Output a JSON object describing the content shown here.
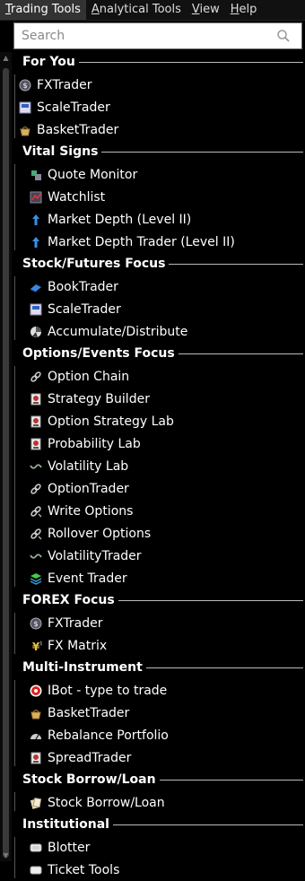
{
  "menubar": {
    "items": [
      {
        "pre": "",
        "mn": "T",
        "post": "rading Tools"
      },
      {
        "pre": "",
        "mn": "A",
        "post": "nalytical Tools"
      },
      {
        "pre": "",
        "mn": "V",
        "post": "iew"
      },
      {
        "pre": "",
        "mn": "H",
        "post": "elp"
      }
    ]
  },
  "search": {
    "placeholder": "Search"
  },
  "sections": [
    {
      "title": "For You",
      "items": [
        "FXTrader",
        "ScaleTrader",
        "BasketTrader"
      ]
    },
    {
      "title": "Vital Signs",
      "items": [
        "Quote Monitor",
        "Watchlist",
        "Market Depth (Level II)",
        "Market Depth Trader (Level II)"
      ]
    },
    {
      "title": "Stock/Futures Focus",
      "items": [
        "BookTrader",
        "ScaleTrader",
        "Accumulate/Distribute"
      ]
    },
    {
      "title": "Options/Events Focus",
      "items": [
        "Option Chain",
        "Strategy Builder",
        "Option Strategy Lab",
        "Probability Lab",
        "Volatility Lab",
        "OptionTrader",
        "Write Options",
        "Rollover Options",
        "VolatilityTrader",
        "Event Trader"
      ]
    },
    {
      "title": "FOREX Focus",
      "items": [
        "FXTrader",
        "FX Matrix"
      ]
    },
    {
      "title": "Multi-Instrument",
      "items": [
        "IBot - type to trade",
        "BasketTrader",
        "Rebalance Portfolio",
        "SpreadTrader"
      ]
    },
    {
      "title": "Stock Borrow/Loan",
      "items": [
        "Stock Borrow/Loan"
      ]
    },
    {
      "title": "Institutional",
      "items": [
        "Blotter",
        "Ticket Tools"
      ]
    }
  ],
  "icons": [
    [
      "fx-globe-icon",
      "scale-icon",
      "basket-icon"
    ],
    [
      "quote-monitor-icon",
      "watchlist-icon",
      "market-depth-icon",
      "market-depth-icon"
    ],
    [
      "booktrader-icon",
      "scale-icon",
      "accumulate-icon"
    ],
    [
      "option-chain-icon",
      "strategy-icon",
      "strategy-icon",
      "strategy-icon",
      "volatility-icon",
      "option-chain-icon",
      "write-options-icon",
      "write-options-icon",
      "volatility-icon",
      "event-trader-icon"
    ],
    [
      "fx-globe-icon",
      "fx-matrix-icon"
    ],
    [
      "ibot-icon",
      "basket-icon",
      "rebalance-icon",
      "strategy-icon"
    ],
    [
      "borrow-icon"
    ],
    [
      "blotter-icon",
      "ticket-icon"
    ]
  ]
}
